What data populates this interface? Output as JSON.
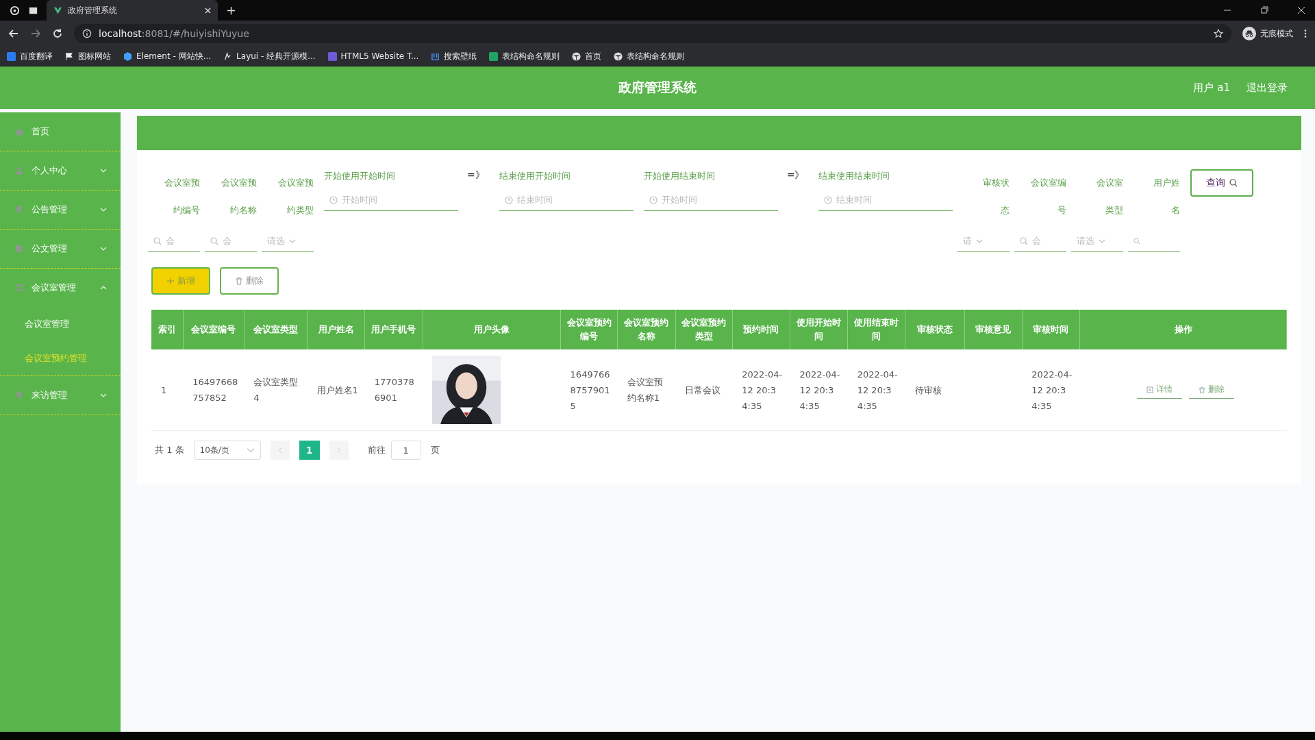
{
  "browser": {
    "tab_title": "政府管理系统",
    "url_host": "localhost",
    "url_rest": ":8081/#/huiyishiYuyue",
    "incognito_label": "无痕模式",
    "bookmarks": [
      "百度翻译",
      "图标网站",
      "Element - 网站快...",
      "Layui - 经典开源模...",
      "HTML5 Website T...",
      "搜索壁纸",
      "表结构命名规则",
      "首页",
      "表结构命名规则"
    ]
  },
  "header": {
    "title": "政府管理系统",
    "user": "用户 a1",
    "logout": "退出登录"
  },
  "sidebar": {
    "items": [
      {
        "label": "首页"
      },
      {
        "label": "个人中心",
        "expanded": false
      },
      {
        "label": "公告管理",
        "expanded": false
      },
      {
        "label": "公文管理",
        "expanded": false
      },
      {
        "label": "会议室管理",
        "expanded": true,
        "children": [
          {
            "label": "会议室管理",
            "selected": false
          },
          {
            "label": "会议室预约管理",
            "selected": true
          }
        ]
      },
      {
        "label": "来访管理",
        "expanded": false
      }
    ]
  },
  "search": {
    "fields": [
      {
        "kind": "text",
        "label": [
          "会议室预",
          "约编号"
        ],
        "placeholder": "会"
      },
      {
        "kind": "text",
        "label": [
          "会议室预",
          "约名称"
        ],
        "placeholder": "会"
      },
      {
        "kind": "select",
        "label": [
          "会议室预",
          "约类型"
        ],
        "placeholder": "请选"
      },
      {
        "kind": "date",
        "label": [
          "开始使用开始时间"
        ],
        "placeholder": "开始时间"
      },
      {
        "kind": "separator",
        "text": "=》"
      },
      {
        "kind": "date",
        "label": [
          "结束使用开始时间"
        ],
        "placeholder": "结束时间"
      },
      {
        "kind": "date",
        "label": [
          "开始使用结束时间"
        ],
        "placeholder": "开始时间"
      },
      {
        "kind": "separator",
        "text": "=》"
      },
      {
        "kind": "date",
        "label": [
          "结束使用结束时间"
        ],
        "placeholder": "结束时间"
      },
      {
        "kind": "select",
        "label": [
          "审核状",
          "态"
        ],
        "placeholder": "请"
      },
      {
        "kind": "text",
        "label": [
          "会议室编",
          "号"
        ],
        "placeholder": "会"
      },
      {
        "kind": "select",
        "label": [
          "会议室",
          "类型"
        ],
        "placeholder": "请选"
      },
      {
        "kind": "text",
        "label": [
          "用户姓",
          "名"
        ]
      }
    ],
    "query_button": "查询"
  },
  "actions": {
    "add": "新增",
    "delete": "删除"
  },
  "table": {
    "columns": [
      "索引",
      "会议室编号",
      "会议室类型",
      "用户姓名",
      "用户手机号",
      "用户头像",
      "会议室预约编号",
      "会议室预约名称",
      "会议室预约类型",
      "预约时间",
      "使用开始时间",
      "使用结束时间",
      "审核状态",
      "审核意见",
      "审核时间",
      "操作"
    ],
    "rows": [
      {
        "cells": [
          "1",
          "16497668757852",
          "会议室类型4",
          "用户姓名1",
          "17703786901",
          {
            "kind": "picture"
          },
          "164976687579015",
          "会议室预约名称1",
          "日常会议",
          "2022-04-12 20:34:35",
          "2022-04-12 20:34:35",
          "2022-04-12 20:34:35",
          "待审核",
          "",
          "2022-04-12 20:34:35",
          {
            "kind": "actions",
            "detail": "详情",
            "delete": "删除"
          }
        ]
      }
    ]
  },
  "pagination": {
    "total": "共 1 条",
    "page_size": "10条/页",
    "pages": [
      {
        "label": "1",
        "selected": true
      }
    ],
    "goto_label": "前往",
    "goto_value": "1",
    "goto_suffix": "页"
  }
}
